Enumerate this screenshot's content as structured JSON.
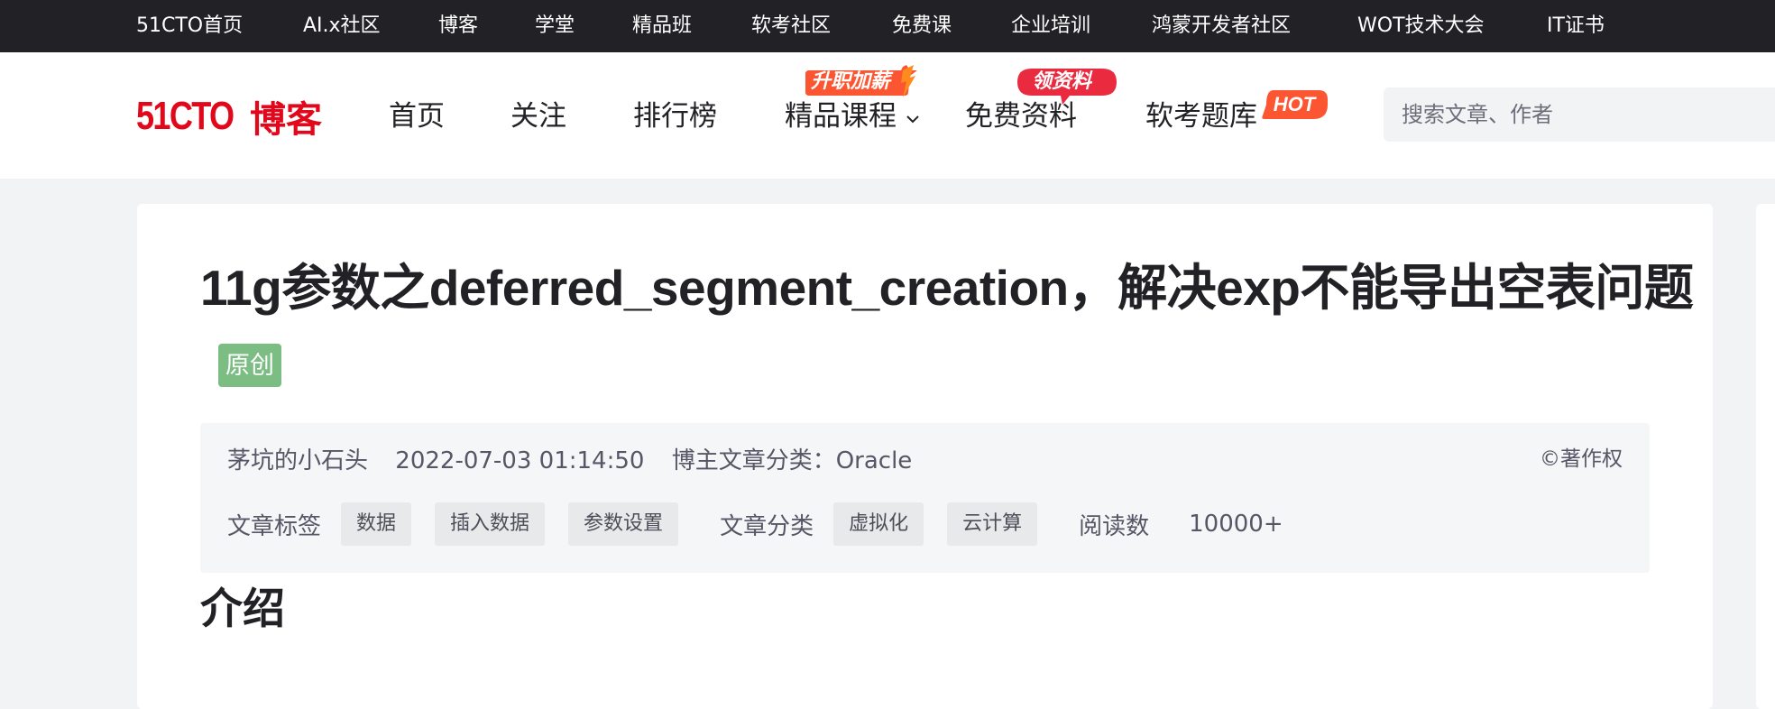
{
  "topbar": {
    "links": [
      {
        "label": "51CTO首页",
        "name": "topbar-link-home"
      },
      {
        "label": "AI.x社区",
        "name": "topbar-link-ai"
      },
      {
        "label": "博客",
        "name": "topbar-link-blog"
      },
      {
        "label": "学堂",
        "name": "topbar-link-school"
      },
      {
        "label": "精品班",
        "name": "topbar-link-premium"
      },
      {
        "label": "软考社区",
        "name": "topbar-link-exam"
      },
      {
        "label": "免费课",
        "name": "topbar-link-free"
      },
      {
        "label": "企业培训",
        "name": "topbar-link-training"
      },
      {
        "label": "鸿蒙开发者社区",
        "name": "topbar-link-harmony"
      },
      {
        "label": "WOT技术大会",
        "name": "topbar-link-wot"
      },
      {
        "label": "IT证书",
        "name": "topbar-link-cert"
      }
    ]
  },
  "header": {
    "logo_number": "51CTO",
    "logo_text": "博客",
    "nav": {
      "home": "首页",
      "follow": "关注",
      "ranking": "排行榜",
      "courses": "精品课程",
      "materials": "免费资料",
      "exam": "软考题库"
    },
    "badges": {
      "upgrade": "升职加薪",
      "material": "领资料",
      "hot": "HOT"
    },
    "search_placeholder": "搜索文章、作者"
  },
  "article": {
    "title": "11g参数之deferred_segment_creation，解决exp不能导出空表问题",
    "original_tag": "原创",
    "author": "茅坑的小石头",
    "datetime": "2022-07-03 01:14:50",
    "category_label": "博主文章分类：Oracle",
    "copyright": "©著作权",
    "tags_label": "文章标签",
    "tags": [
      "数据",
      "插入数据",
      "参数设置"
    ],
    "categories_label": "文章分类",
    "categories": [
      "虚拟化",
      "云计算"
    ],
    "reads_label": "阅读数",
    "reads": "10000+",
    "section_heading": "介绍"
  },
  "colors": {
    "brand_red": "#e1081b",
    "topbar_bg": "#222226",
    "original_green": "#7cbd83",
    "hot_orange": "#fc5531"
  }
}
